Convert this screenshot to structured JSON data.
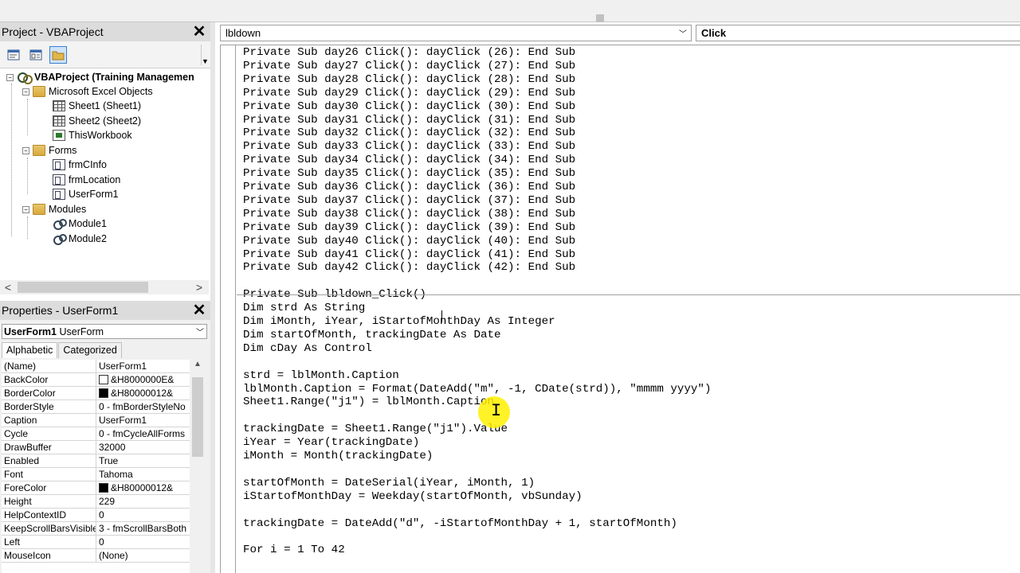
{
  "project_panel": {
    "title": "Project - VBAProject",
    "tree": [
      {
        "label": "VBAProject (Training Managemen",
        "bold": true
      },
      {
        "label": "Microsoft Excel Objects"
      },
      {
        "label": "Sheet1 (Sheet1)"
      },
      {
        "label": "Sheet2 (Sheet2)"
      },
      {
        "label": "ThisWorkbook"
      },
      {
        "label": "Forms"
      },
      {
        "label": "frmCInfo"
      },
      {
        "label": "frmLocation"
      },
      {
        "label": "UserForm1"
      },
      {
        "label": "Modules"
      },
      {
        "label": "Module1"
      },
      {
        "label": "Module2"
      }
    ]
  },
  "properties_panel": {
    "title": "Properties - UserForm1",
    "object_name": "UserForm1",
    "object_type": "UserForm",
    "tabs": [
      "Alphabetic",
      "Categorized"
    ],
    "rows": [
      {
        "name": "(Name)",
        "value": "UserForm1"
      },
      {
        "name": "BackColor",
        "value": "&H8000000E&",
        "swatch": "#ffffff"
      },
      {
        "name": "BorderColor",
        "value": "&H80000012&",
        "swatch": "#000000"
      },
      {
        "name": "BorderStyle",
        "value": "0 - fmBorderStyleNo"
      },
      {
        "name": "Caption",
        "value": "UserForm1"
      },
      {
        "name": "Cycle",
        "value": "0 - fmCycleAllForms"
      },
      {
        "name": "DrawBuffer",
        "value": "32000"
      },
      {
        "name": "Enabled",
        "value": "True"
      },
      {
        "name": "Font",
        "value": "Tahoma"
      },
      {
        "name": "ForeColor",
        "value": "&H80000012&",
        "swatch": "#000000"
      },
      {
        "name": "Height",
        "value": "229"
      },
      {
        "name": "HelpContextID",
        "value": "0"
      },
      {
        "name": "KeepScrollBarsVisible",
        "value": "3 - fmScrollBarsBoth"
      },
      {
        "name": "Left",
        "value": "0"
      },
      {
        "name": "MouseIcon",
        "value": "(None)"
      }
    ]
  },
  "code_window": {
    "object_combo": "lbldown",
    "procedure_combo": "Click",
    "code_lines": [
      "Private Sub day26 Click(): dayClick (26): End Sub",
      "Private Sub day27 Click(): dayClick (27): End Sub",
      "Private Sub day28 Click(): dayClick (28): End Sub",
      "Private Sub day29 Click(): dayClick (29): End Sub",
      "Private Sub day30 Click(): dayClick (30): End Sub",
      "Private Sub day31 Click(): dayClick (31): End Sub",
      "Private Sub day32 Click(): dayClick (32): End Sub",
      "Private Sub day33 Click(): dayClick (33): End Sub",
      "Private Sub day34 Click(): dayClick (34): End Sub",
      "Private Sub day35 Click(): dayClick (35): End Sub",
      "Private Sub day36 Click(): dayClick (36): End Sub",
      "Private Sub day37 Click(): dayClick (37): End Sub",
      "Private Sub day38 Click(): dayClick (38): End Sub",
      "Private Sub day39 Click(): dayClick (39): End Sub",
      "Private Sub day40 Click(): dayClick (40): End Sub",
      "Private Sub day41 Click(): dayClick (41): End Sub",
      "Private Sub day42 Click(): dayClick (42): End Sub",
      "",
      "Private Sub lbldown_Click()",
      "Dim strd As String",
      "Dim iMonth, iYear, iStartofMonthDay As Integer",
      "Dim startOfMonth, trackingDate As Date",
      "Dim cDay As Control",
      "",
      "strd = lblMonth.Caption",
      "lblMonth.Caption = Format(DateAdd(\"m\", -1, CDate(strd)), \"mmmm yyyy\")",
      "Sheet1.Range(\"j1\") = lblMonth.Caption",
      "",
      "trackingDate = Sheet1.Range(\"j1\").Value",
      "iYear = Year(trackingDate)",
      "iMonth = Month(trackingDate)",
      "",
      "startOfMonth = DateSerial(iYear, iMonth, 1)",
      "iStartofMonthDay = Weekday(startOfMonth, vbSunday)",
      "",
      "trackingDate = DateAdd(\"d\", -iStartofMonthDay + 1, startOfMonth)",
      "",
      "For i = 1 To 42"
    ]
  }
}
